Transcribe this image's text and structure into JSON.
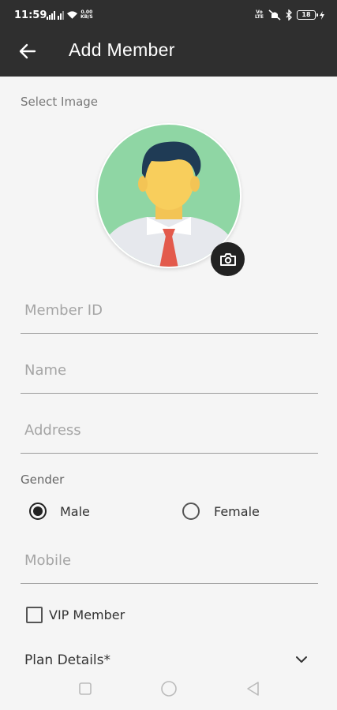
{
  "status_bar": {
    "time": "11:59",
    "data_speed_value": "0.00",
    "data_speed_unit": "KB/S",
    "volte_top": "Vo",
    "volte_bottom": "LTE",
    "battery_level": "18"
  },
  "header": {
    "title": "Add Member",
    "icon": "arrow-left-icon"
  },
  "form": {
    "select_image_label": "Select Image",
    "member_id_placeholder": "Member ID",
    "member_id_value": "",
    "name_placeholder": "Name",
    "name_value": "",
    "address_placeholder": "Address",
    "address_value": "",
    "gender_label": "Gender",
    "gender_options": [
      "Male",
      "Female"
    ],
    "gender_selected": "Male",
    "mobile_placeholder": "Mobile",
    "mobile_value": "",
    "vip_label": "VIP Member",
    "vip_checked": false,
    "plan_details_label": "Plan Details*"
  },
  "colors": {
    "appbar": "#2f2f2f",
    "background": "#f5f5f5",
    "avatar_bg": "#8fd6a4",
    "camera_button": "#222222"
  }
}
